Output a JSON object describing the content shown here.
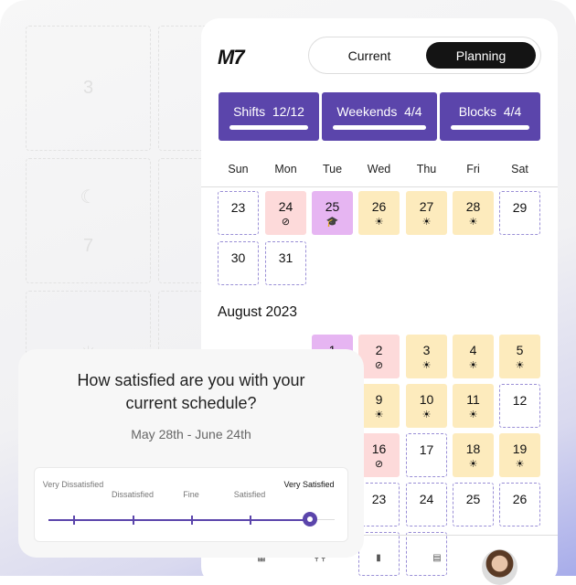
{
  "background": {
    "ghost_cells": [
      "3",
      "☾",
      "7",
      "☀"
    ]
  },
  "app": {
    "logo": "M7",
    "toggle": {
      "current": "Current",
      "planning": "Planning",
      "selected": "Planning"
    }
  },
  "stats": [
    {
      "label": "Shifts",
      "value": "12/12",
      "progress": 1.0
    },
    {
      "label": "Weekends",
      "value": "4/4",
      "progress": 1.0
    },
    {
      "label": "Blocks",
      "value": "4/4",
      "progress": 1.0
    }
  ],
  "weekdays": [
    "Sun",
    "Mon",
    "Tue",
    "Wed",
    "Thu",
    "Fri",
    "Sat"
  ],
  "july_rows": [
    [
      {
        "d": "23",
        "t": "dash"
      },
      {
        "d": "24",
        "t": "pink",
        "i": "⊘"
      },
      {
        "d": "25",
        "t": "purple",
        "i": "🎓"
      },
      {
        "d": "26",
        "t": "yellow",
        "i": "☀"
      },
      {
        "d": "27",
        "t": "yellow",
        "i": "☀"
      },
      {
        "d": "28",
        "t": "yellow",
        "i": "☀"
      },
      {
        "d": "29",
        "t": "dash"
      }
    ],
    [
      {
        "d": "30",
        "t": "dash"
      },
      {
        "d": "31",
        "t": "dash"
      }
    ]
  ],
  "august": {
    "title": "August 2023",
    "rows": [
      [
        null,
        null,
        {
          "d": "1",
          "t": "purple"
        },
        {
          "d": "2",
          "t": "pink",
          "i": "⊘"
        },
        {
          "d": "3",
          "t": "yellow",
          "i": "☀"
        },
        {
          "d": "4",
          "t": "yellow",
          "i": "☀"
        },
        {
          "d": "5",
          "t": "yellow",
          "i": "☀"
        }
      ],
      [
        null,
        null,
        null,
        {
          "d": "9",
          "t": "yellow",
          "i": "☀"
        },
        {
          "d": "10",
          "t": "yellow",
          "i": "☀"
        },
        {
          "d": "11",
          "t": "yellow",
          "i": "☀"
        },
        {
          "d": "12",
          "t": "dash"
        }
      ],
      [
        null,
        null,
        null,
        {
          "d": "16",
          "t": "pink",
          "i": "⊘"
        },
        {
          "d": "17",
          "t": "dash"
        },
        {
          "d": "18",
          "t": "yellow",
          "i": "☀"
        },
        {
          "d": "19",
          "t": "yellow",
          "i": "☀"
        }
      ],
      [
        null,
        null,
        null,
        {
          "d": "23",
          "t": "dash"
        },
        {
          "d": "24",
          "t": "dash"
        },
        {
          "d": "25",
          "t": "dash"
        },
        {
          "d": "26",
          "t": "dash"
        }
      ]
    ]
  },
  "nav": [
    {
      "icon": "calendar-icon",
      "glyph": "▦"
    },
    {
      "icon": "requests-icon",
      "glyph": "⚲⚲"
    },
    {
      "icon": "statistics-icon",
      "glyph": "▮"
    },
    {
      "icon": "feedback-icon",
      "glyph": "▤"
    }
  ],
  "survey": {
    "question": "How satisfied are you with your current schedule?",
    "range": "May 28th - June 24th",
    "options": [
      "Very Dissatisfied",
      "Dissatisfied",
      "Fine",
      "Satisfied",
      "Very Satisfied"
    ],
    "selected_index": 4
  },
  "colors": {
    "accent": "#5b45ab",
    "off": "#fddada",
    "training": "#e6b5f2",
    "day_shift": "#fdebbd",
    "available_border": "#9a8fd6"
  }
}
